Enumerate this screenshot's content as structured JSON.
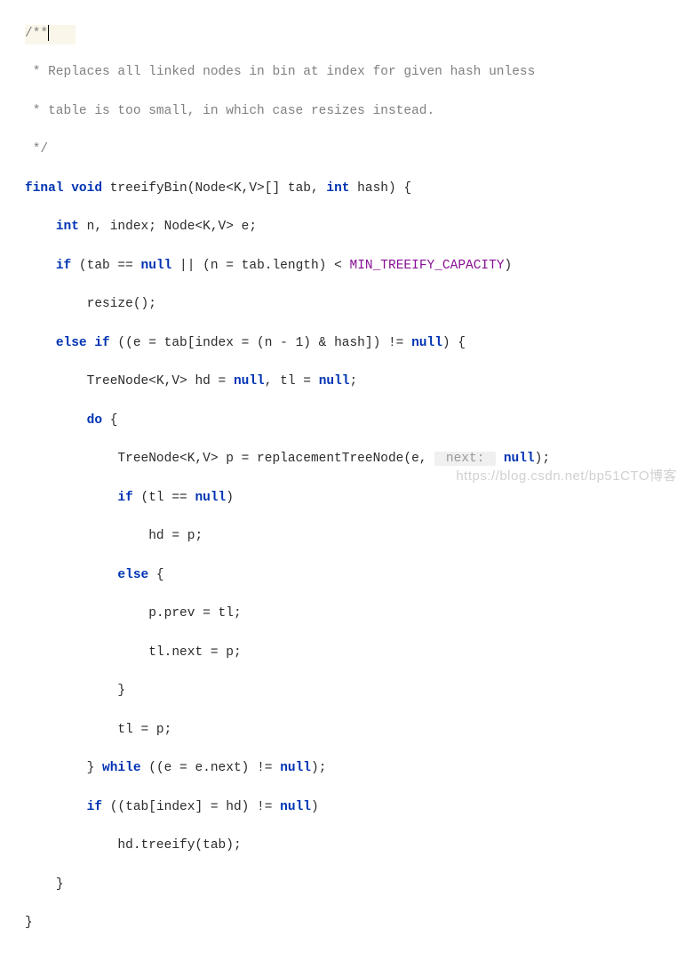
{
  "doc": {
    "l1": "/**",
    "l2": " * Replaces all linked nodes in bin at index for given hash unless",
    "l3": " * table is too small, in which case resizes instead.",
    "l4": " */"
  },
  "kw": {
    "final": "final",
    "void": "void",
    "int": "int",
    "if": "if",
    "null": "null",
    "else": "else",
    "do": "do",
    "while": "while"
  },
  "code": {
    "sig1": " treeifyBin(Node<K,V>[] tab, ",
    "sig2": " hash) {",
    "decl1": " n, index; Node<K,V> e;",
    "if1a": " (tab == ",
    "if1b": " || (n = tab.length) < ",
    "if1c": ")",
    "resize": "resize();",
    "elseif1a": " ((e = tab[index = (n - 1) & hash]) != ",
    "elseif1b": ") {",
    "treenode_decl_a": "TreeNode<K,V> hd = ",
    "treenode_decl_b": ", tl = ",
    "treenode_decl_c": ";",
    "do_open": " {",
    "p_decl_a": "TreeNode<K,V> p = replacementTreeNode(e, ",
    "p_decl_b": ");",
    "if_tl_a": " (tl == ",
    "if_tl_b": ")",
    "hd_p": "hd = p;",
    "else_open": " {",
    "pprev": "p.prev = tl;",
    "tlnext": "tl.next = p;",
    "brace_close": "}",
    "tl_p": "tl = p;",
    "while_a": "} ",
    "while_b": " ((e = e.next) != ",
    "while_c": ");",
    "if_tab_a": " ((tab[index] = hd) != ",
    "if_tab_b": ")",
    "treeify": "hd.treeify(tab);"
  },
  "const": {
    "min_treeify": "MIN_TREEIFY_CAPACITY"
  },
  "hint": {
    "next": " next: ",
    "next_val": "null"
  },
  "watermark": "https://blog.csdn.net/bp51CTO博客"
}
